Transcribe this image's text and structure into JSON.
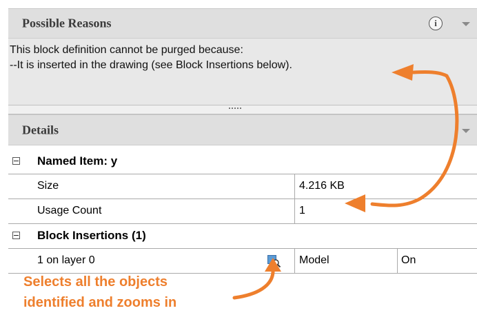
{
  "possible_reasons": {
    "title": "Possible Reasons",
    "line1": "This block definition cannot be purged because:",
    "line2": "--It is inserted in the drawing (see Block Insertions below)."
  },
  "details": {
    "title": "Details",
    "named_item": {
      "label": "Named Item: y",
      "properties": [
        {
          "name": "Size",
          "value": "4.216 KB"
        },
        {
          "name": "Usage Count",
          "value": "1"
        }
      ]
    },
    "block_insertions": {
      "label": "Block Insertions (1)",
      "rows": [
        {
          "name": "1 on layer 0",
          "space": "Model",
          "state": "On"
        }
      ]
    }
  },
  "annotation": {
    "line1": "Selects all the objects",
    "line2": "identified and zooms in"
  },
  "icons": {
    "info": "info-icon",
    "dropdown": "chevron-down-icon",
    "zoom": "zoom-to-object-icon",
    "expander": "collapse-icon"
  },
  "colors": {
    "annotation": "#ee7f2d",
    "header_bg": "#dfdfdf"
  }
}
